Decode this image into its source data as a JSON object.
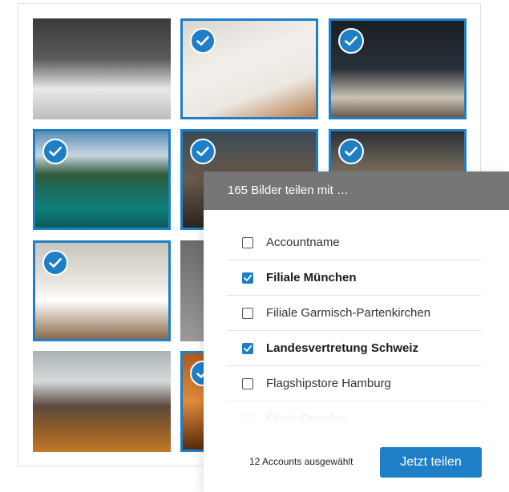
{
  "gallery": {
    "tiles": [
      {
        "photo": "bedroom-dark",
        "selected": false
      },
      {
        "photo": "chair",
        "selected": true
      },
      {
        "photo": "bar",
        "selected": true
      },
      {
        "photo": "lake",
        "selected": true
      },
      {
        "photo": "cafe",
        "selected": true
      },
      {
        "photo": "restaurant",
        "selected": true
      },
      {
        "photo": "bedroom-light",
        "selected": true
      },
      {
        "photo": "mirror",
        "selected": false
      },
      {
        "photo": "mountain",
        "selected": false
      },
      {
        "photo": "autumn",
        "selected": true
      }
    ]
  },
  "share_panel": {
    "title": "165 Bilder teilen mit …",
    "accounts": [
      {
        "label": "Accountname",
        "checked": false
      },
      {
        "label": "Filiale München",
        "checked": true
      },
      {
        "label": "Filiale Garmisch-Partenkirchen",
        "checked": false
      },
      {
        "label": "Landesvertretung Schweiz",
        "checked": true
      },
      {
        "label": "Flagshipstore Hamburg",
        "checked": false
      },
      {
        "label": "Filiale Dresden",
        "checked": false
      }
    ],
    "selected_count": "12 Accounts ausgewählt",
    "share_label": "Jetzt teilen"
  },
  "colors": {
    "accent": "#1f7fc6",
    "header_bg": "#767676"
  },
  "icons": {
    "selection": "check-circle-icon",
    "checkbox_checked": "checkmark-icon"
  }
}
